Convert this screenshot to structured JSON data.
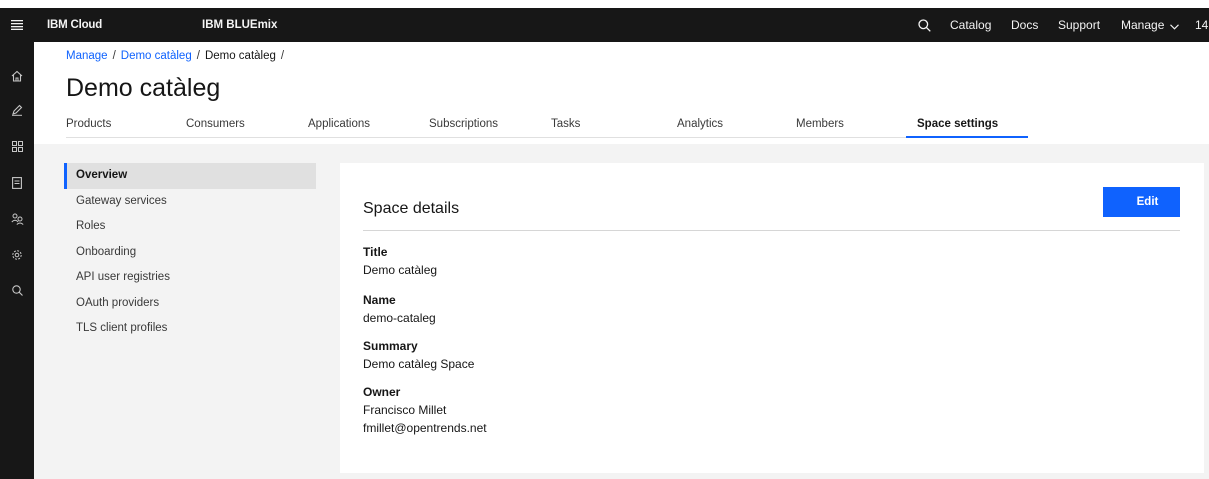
{
  "header": {
    "brand": "IBM Cloud",
    "product": "IBM BLUEmix",
    "links": [
      "Catalog",
      "Docs",
      "Support",
      "Manage"
    ],
    "overflow_text": "14"
  },
  "rail": {
    "icons": [
      "home-icon",
      "edit-icon",
      "apps-grid-icon",
      "catalog-icon",
      "users-icon",
      "settings-icon",
      "search-icon"
    ]
  },
  "breadcrumb": {
    "items": [
      "Manage",
      "Demo catàleg",
      "Demo catàleg"
    ],
    "separator": "/"
  },
  "page": {
    "title": "Demo catàleg"
  },
  "tabs": {
    "items": [
      "Products",
      "Consumers",
      "Applications",
      "Subscriptions",
      "Tasks",
      "Analytics",
      "Members",
      "Space settings"
    ],
    "active": "Space settings"
  },
  "sidenav": {
    "items": [
      "Overview",
      "Gateway services",
      "Roles",
      "Onboarding",
      "API user registries",
      "OAuth providers",
      "TLS client profiles"
    ],
    "active": "Overview"
  },
  "details": {
    "heading": "Space details",
    "edit_label": "Edit",
    "title_label": "Title",
    "title_value": "Demo catàleg",
    "name_label": "Name",
    "name_value": "demo-cataleg",
    "summary_label": "Summary",
    "summary_value": "Demo catàleg Space",
    "owner_label": "Owner",
    "owner_name": "Francisco Millet",
    "owner_email": "fmillet@opentrends.net"
  },
  "colors": {
    "header_bg": "#171717",
    "accent": "#0f62fe",
    "content_bg": "#f3f3f3"
  }
}
